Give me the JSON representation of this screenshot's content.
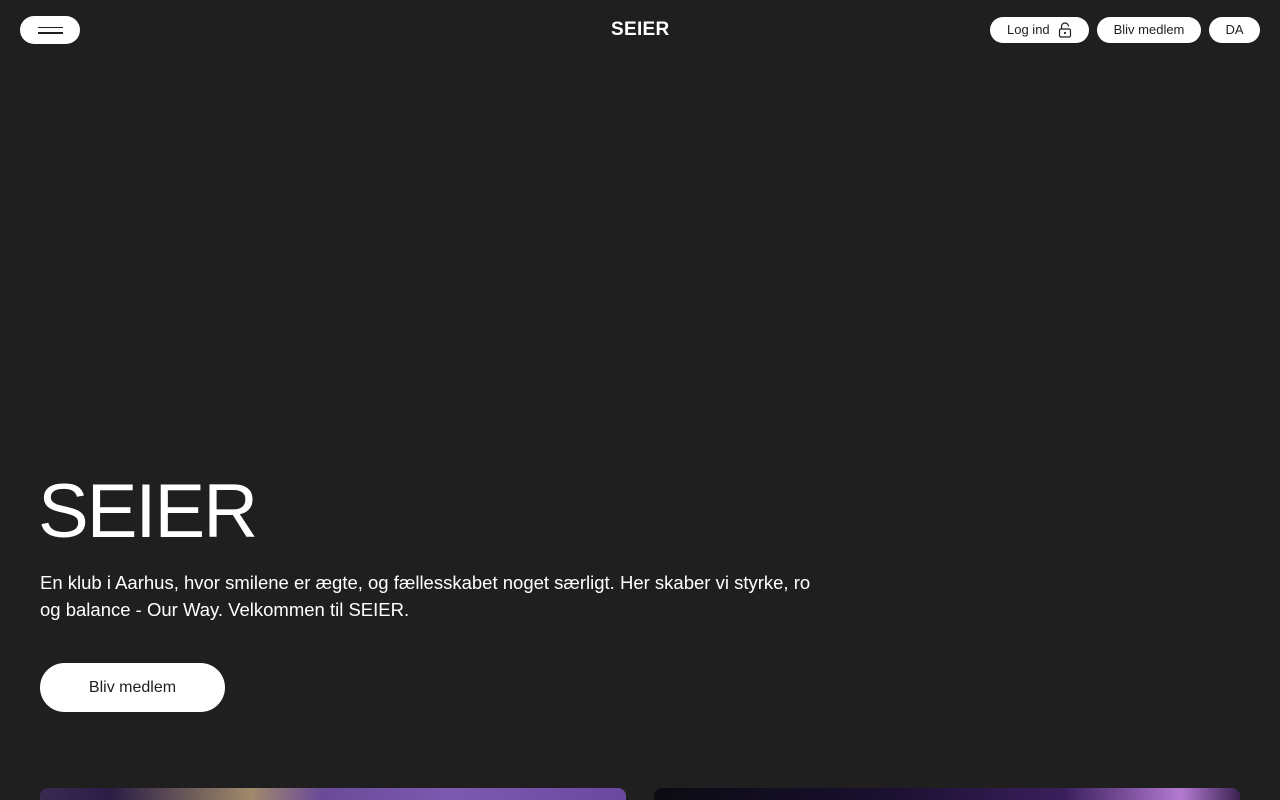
{
  "header": {
    "logo": "SEIER",
    "menu_icon": "hamburger-icon",
    "login_label": "Log ind",
    "login_icon": "lock-icon",
    "join_label": "Bliv medlem",
    "language_label": "DA"
  },
  "hero": {
    "title": "SEIER",
    "text": "En klub i Aarhus, hvor smilene er ægte, og fællesskabet noget særligt. Her skaber vi styrke, ro og balance - Our Way. Velkommen til SEIER.",
    "cta_label": "Bliv medlem"
  },
  "colors": {
    "background": "#1f1f1f",
    "button": "#ffffff",
    "text": "#ffffff"
  }
}
